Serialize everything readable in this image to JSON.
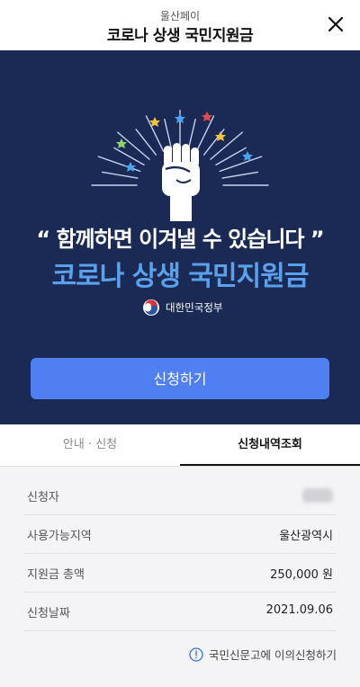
{
  "header": {
    "subtitle": "울산페이",
    "title": "코로나 상생 국민지원금",
    "close_icon": "close-icon"
  },
  "hero": {
    "slogan": "“ 함께하면 이겨낼 수 있습니다 ”",
    "title": "코로나 상생 국민지원금",
    "gov_label": "대한민국정부",
    "apply_button": "신청하기",
    "colors": {
      "background": "#1b2a55",
      "title": "#5aa0ea",
      "button": "#4f7ff0"
    }
  },
  "tabs": [
    {
      "label": "안내 · 신청",
      "active": false
    },
    {
      "label": "신청내역조회",
      "active": true
    }
  ],
  "details": {
    "rows": [
      {
        "label": "신청자",
        "value": ""
      },
      {
        "label": "사용가능지역",
        "value": "울산광역시"
      },
      {
        "label": "지원금 총액",
        "value": "250,000 원"
      },
      {
        "label": "신청날짜",
        "value": "2021.09.06"
      }
    ],
    "objection_link": "국민신문고에 이의신청하기",
    "objection_icon": "info-circle-icon"
  }
}
